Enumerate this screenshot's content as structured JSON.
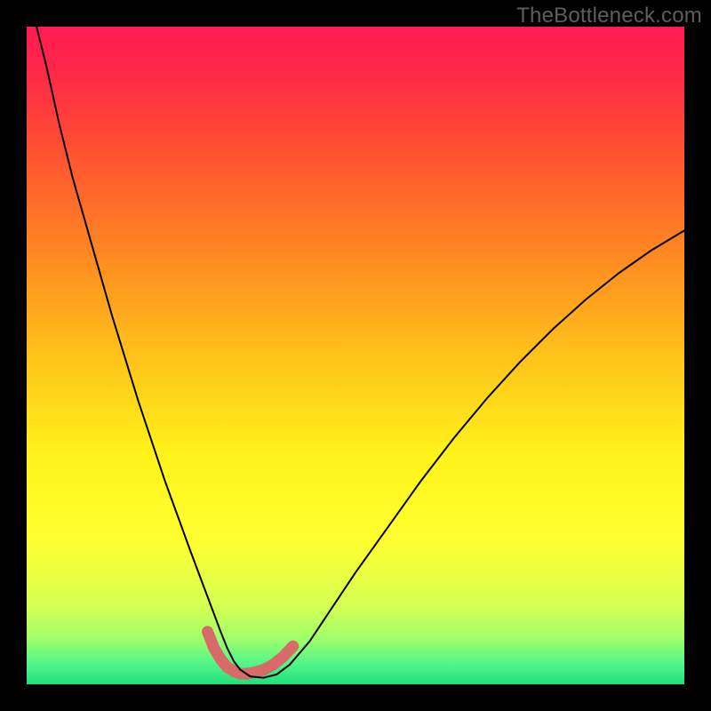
{
  "watermark": "TheBottleneck.com",
  "chart_data": {
    "type": "line",
    "title": "",
    "xlabel": "",
    "ylabel": "",
    "xlim": [
      0,
      100
    ],
    "ylim": [
      0,
      100
    ],
    "background_gradient": {
      "stops": [
        {
          "offset": 0.0,
          "color": "#ff1a54"
        },
        {
          "offset": 0.08,
          "color": "#ff2b46"
        },
        {
          "offset": 0.2,
          "color": "#ff5530"
        },
        {
          "offset": 0.35,
          "color": "#ff8a22"
        },
        {
          "offset": 0.5,
          "color": "#ffc21a"
        },
        {
          "offset": 0.65,
          "color": "#fff31a"
        },
        {
          "offset": 0.78,
          "color": "#ffff30"
        },
        {
          "offset": 0.88,
          "color": "#d6ff52"
        },
        {
          "offset": 0.93,
          "color": "#a0ff6a"
        },
        {
          "offset": 0.97,
          "color": "#50f58a"
        },
        {
          "offset": 1.0,
          "color": "#1fe07a"
        }
      ]
    },
    "series": [
      {
        "name": "curve-main",
        "color": "#000000",
        "width": 2,
        "x": [
          1.5,
          3,
          5,
          7,
          9,
          11,
          13,
          15,
          17,
          19,
          21,
          23,
          25,
          26.5,
          28,
          29.5,
          30.5,
          31.5,
          32.5,
          34,
          36,
          38,
          40,
          43,
          46,
          50,
          55,
          60,
          65,
          70,
          75,
          80,
          85,
          90,
          95,
          100
        ],
        "y": [
          100,
          94,
          85,
          77,
          70,
          63,
          56,
          49.5,
          43,
          37,
          31,
          25.5,
          20,
          16,
          12,
          8,
          5.5,
          3.5,
          2.2,
          1.2,
          1.0,
          1.5,
          3.0,
          6.5,
          11,
          17,
          24,
          31,
          37.5,
          43.5,
          49,
          54,
          58.5,
          62.5,
          66,
          69
        ]
      },
      {
        "name": "curve-highlight",
        "color": "#d86a6a",
        "width": 13,
        "x": [
          27.5,
          28.5,
          29.5,
          30.5,
          31.5,
          32.5,
          33.5,
          34.5,
          36,
          37.5,
          39,
          40.5
        ],
        "y": [
          8.0,
          5.5,
          3.8,
          2.6,
          2.0,
          1.6,
          1.6,
          1.8,
          2.2,
          3.0,
          4.2,
          5.8
        ]
      }
    ]
  }
}
